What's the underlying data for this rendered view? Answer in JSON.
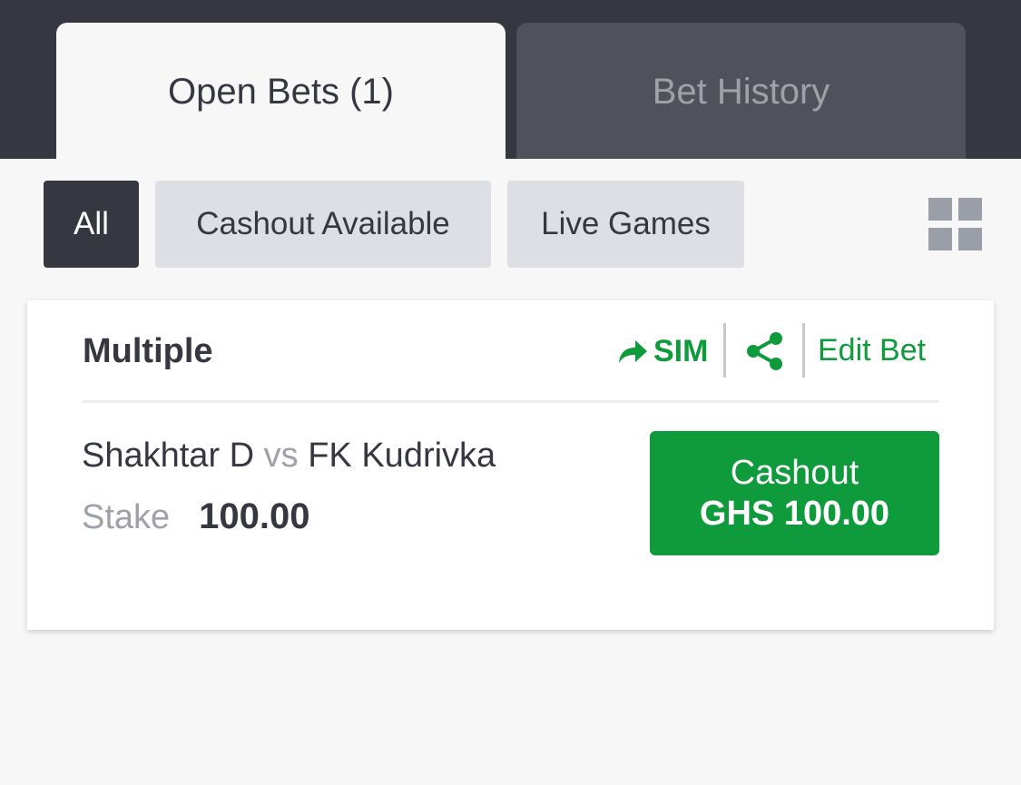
{
  "tabs": {
    "open_bets": "Open Bets (1)",
    "bet_history": "Bet History"
  },
  "filters": {
    "all": "All",
    "cashout_available": "Cashout Available",
    "live_games": "Live Games"
  },
  "view_toggle_icon": "grid-icon",
  "bet": {
    "type": "Multiple",
    "sim_label": "SIM",
    "sim_icon": "forward-arrow-icon",
    "share_icon": "share-icon",
    "edit_label": "Edit Bet",
    "home_team": "Shakhtar D",
    "vs": "vs",
    "away_team": "FK Kudrivka",
    "stake_label": "Stake",
    "stake_value": "100.00",
    "cashout_label": "Cashout",
    "cashout_amount": "GHS 100.00"
  },
  "colors": {
    "header_bg": "#353841",
    "accent_green": "#0f9a3b",
    "chip_bg": "#dedfe5"
  }
}
